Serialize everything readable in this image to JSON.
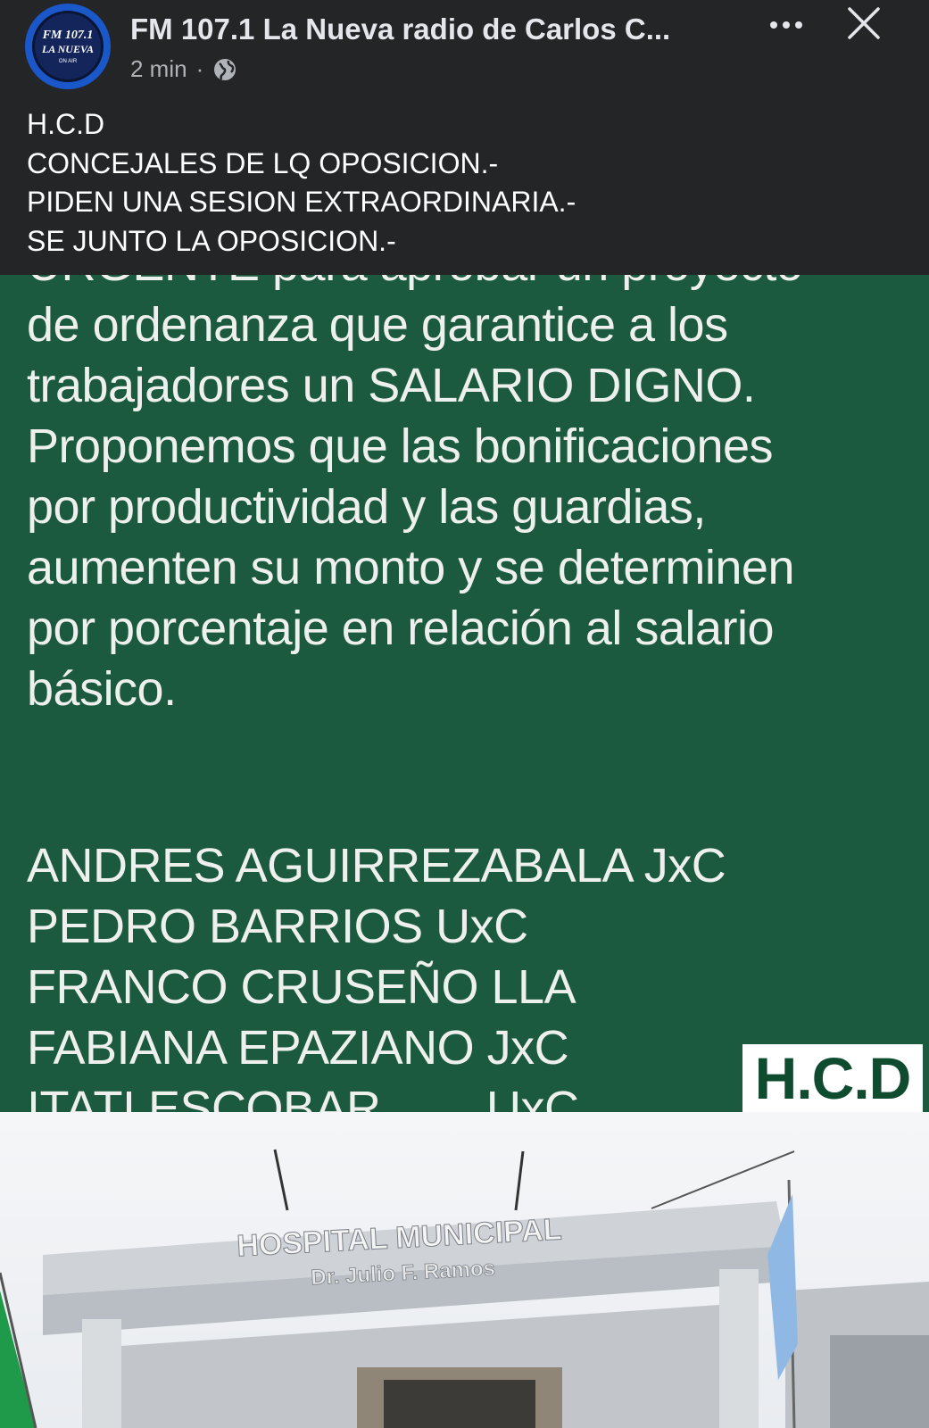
{
  "post": {
    "page_name": "FM 107.1 La Nueva radio de Carlos C...",
    "time": "2 min",
    "separator": "·",
    "privacy_icon": "globe-icon",
    "more_icon": "more-icon",
    "close_icon": "close-icon",
    "avatar_text": [
      "FM 107.1",
      "LA NUEVA",
      "ON AIR"
    ],
    "text_lines": [
      "H.C.D",
      "CONCEJALES DE LQ OPOSICION.-",
      "PIDEN UNA SESION EXTRAORDINARIA.-",
      "SE JUNTO LA OPOSICION.-"
    ]
  },
  "image": {
    "body_lines": [
      "URGENTE para aprobar un proyecto",
      "de ordenanza que garantice a los",
      "trabajadores un SALARIO DIGNO.",
      "Proponemos que las bonificaciones",
      "por productividad y las guardias,",
      "aumenten su monto y se determinen",
      "por porcentaje en relación al salario",
      "básico."
    ],
    "signatories": [
      {
        "name": "ANDRES AGUIRREZABALA JxC",
        "party": ""
      },
      {
        "name": "PEDRO BARRIOS  UxC",
        "party": ""
      },
      {
        "name": "FRANCO CRUSEÑO LLA",
        "party": ""
      },
      {
        "name": "FABIANA EPAZIANO JxC",
        "party": ""
      },
      {
        "name": "ITATI ESCOBAR",
        "party": "UxC"
      }
    ],
    "logo_text": "H.C.D",
    "sign_title": "HOSPITAL MUNICIPAL",
    "sign_subtitle": "Dr. Julio F. Ramos"
  },
  "colors": {
    "background": "#242526",
    "green_panel": "#1c5a3f",
    "text": "#e4e6eb",
    "avatar_ring": "#1a57c8"
  }
}
